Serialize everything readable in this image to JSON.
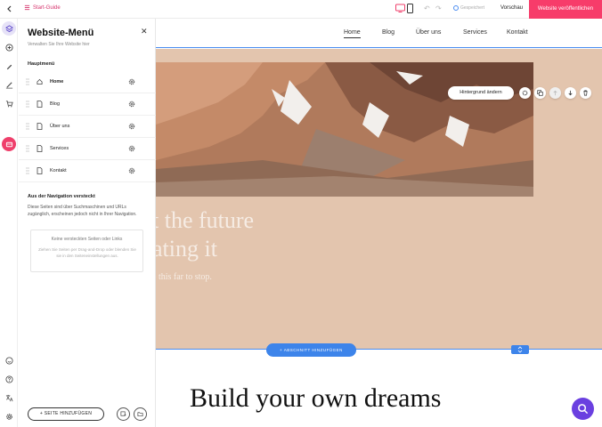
{
  "topbar": {
    "back_icon": "arrow-left-icon",
    "guide_label": "Start-Guide",
    "saved_label": "Gespeichert",
    "preview_label": "Vorschau",
    "publish_label": "Website veröffentlichen",
    "publish_color": "#f73c6a"
  },
  "panel": {
    "title": "Website-Menü",
    "subtitle": "Verwalten Sie Ihre Website hier",
    "main_menu_heading": "Hauptmenü",
    "pages": [
      {
        "label": "Home",
        "icon": "home-icon"
      },
      {
        "label": "Blog",
        "icon": "page-icon"
      },
      {
        "label": "Über uns",
        "icon": "page-icon"
      },
      {
        "label": "Services",
        "icon": "page-icon"
      },
      {
        "label": "Kontakt",
        "icon": "page-icon"
      }
    ],
    "hidden_heading": "Aus der Navigation versteckt",
    "hidden_desc": "Diese Seiten sind über Suchmaschinen und URLs zugänglich, erscheinen jedoch nicht in Ihrer Navigation.",
    "empty_title": "Keine versteckten Seiten oder Links",
    "empty_desc": "Ziehen Sie Seiten per Drag-and-Drop oder blenden Sie sie in den Seiteneinstellungen aus.",
    "add_page_label": "+ SEITE HINZUFÜGEN"
  },
  "site": {
    "nav": [
      "Home",
      "Blog",
      "Über uns",
      "Services",
      "Kontakt"
    ],
    "hero_line1": "t the future",
    "hero_line2": "ating it",
    "hero_sub": "e this far to stop.",
    "bg_button": "Hintergrund ändern",
    "add_section": "+ ABSCHNITT HINZUFÜGEN",
    "heading": "Build your own dreams",
    "hero_bg": "#e3c5ae",
    "accent": "#3d84ea"
  }
}
